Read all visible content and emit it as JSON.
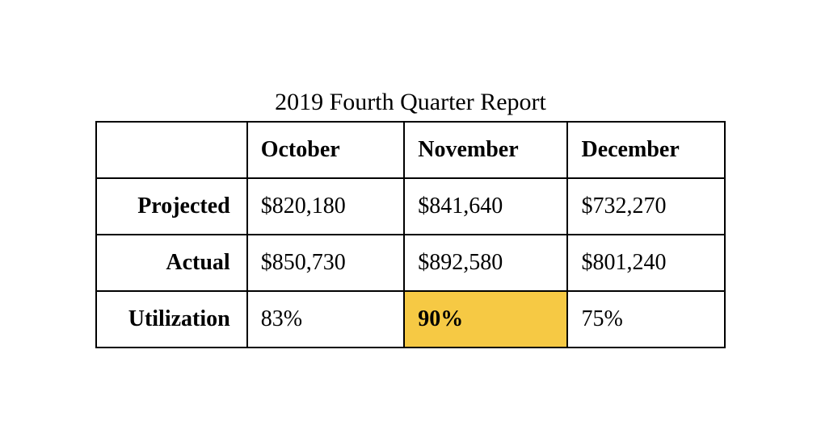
{
  "title": "2019 Fourth Quarter Report",
  "columns": [
    "October",
    "November",
    "December"
  ],
  "rows": [
    {
      "label": "Projected",
      "values": [
        "$820,180",
        "$841,640",
        "$732,270"
      ]
    },
    {
      "label": "Actual",
      "values": [
        "$850,730",
        "$892,580",
        "$801,240"
      ]
    },
    {
      "label": "Utilization",
      "values": [
        "83%",
        "90%",
        "75%"
      ],
      "highlight_index": 1
    }
  ],
  "chart_data": {
    "type": "table",
    "title": "2019 Fourth Quarter Report",
    "categories": [
      "October",
      "November",
      "December"
    ],
    "series": [
      {
        "name": "Projected",
        "values": [
          820180,
          841640,
          732270
        ]
      },
      {
        "name": "Actual",
        "values": [
          850730,
          892580,
          801240
        ]
      },
      {
        "name": "Utilization",
        "values": [
          83,
          90,
          75
        ]
      }
    ]
  }
}
